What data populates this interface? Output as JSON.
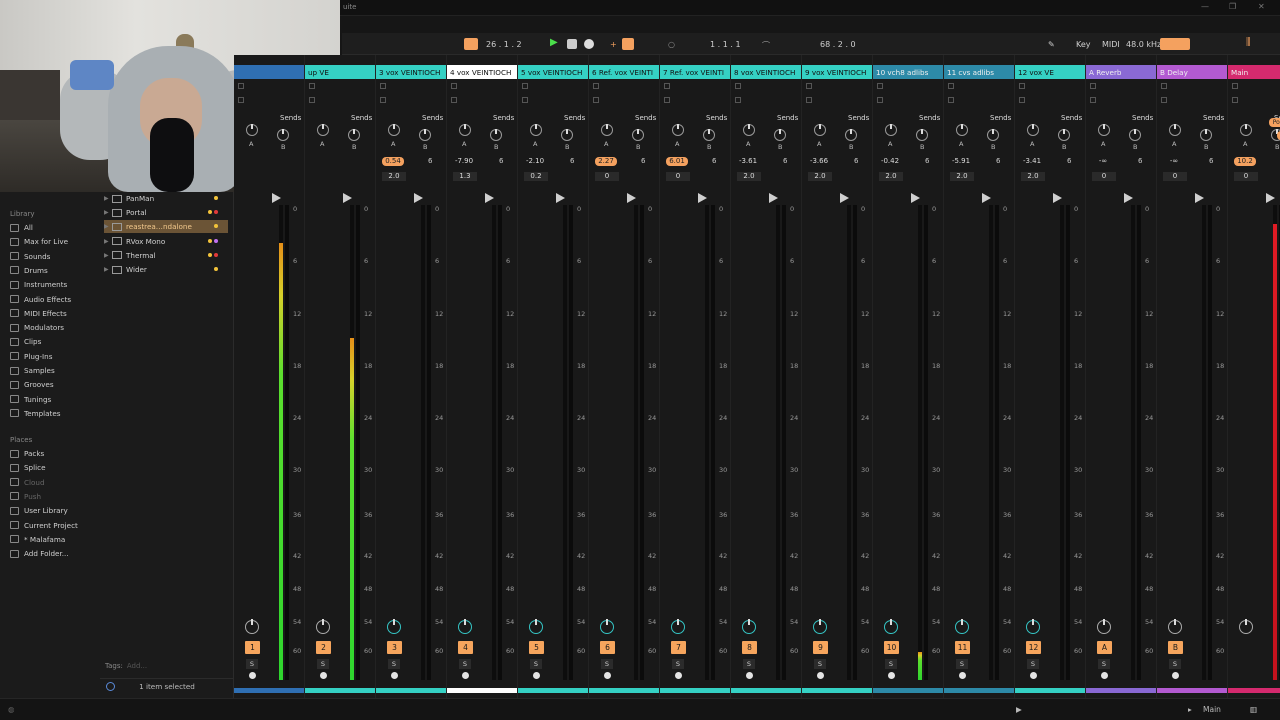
{
  "window": {
    "title_fragment": "uite"
  },
  "transport": {
    "tempo_bar": "26 .  1 .  2",
    "arrangement_pos": "1 .  1 .  1",
    "loop_len": "68 .  2 .  0",
    "key_label": "Key",
    "midi_label": "MIDI",
    "sample_rate": "48.0 kHz",
    "accent": "#f4a15f"
  },
  "library": {
    "title": "Library",
    "items": [
      {
        "label": "All",
        "icon": "list-icon"
      },
      {
        "label": "Max for Live",
        "icon": "max-icon"
      },
      {
        "label": "Sounds",
        "icon": "sounds-icon"
      },
      {
        "label": "Drums",
        "icon": "drums-icon"
      },
      {
        "label": "Instruments",
        "icon": "instruments-icon"
      },
      {
        "label": "Audio Effects",
        "icon": "audio-effects-icon"
      },
      {
        "label": "MIDI Effects",
        "icon": "midi-effects-icon"
      },
      {
        "label": "Modulators",
        "icon": "modulators-icon"
      },
      {
        "label": "Clips",
        "icon": "clips-icon"
      },
      {
        "label": "Plug-Ins",
        "icon": "plugins-icon"
      },
      {
        "label": "Samples",
        "icon": "samples-icon"
      },
      {
        "label": "Grooves",
        "icon": "grooves-icon"
      },
      {
        "label": "Tunings",
        "icon": "tunings-icon"
      },
      {
        "label": "Templates",
        "icon": "templates-icon"
      }
    ],
    "places_title": "Places",
    "places": [
      {
        "label": "Packs",
        "dim": false
      },
      {
        "label": "Splice",
        "dim": false
      },
      {
        "label": "Cloud",
        "dim": true
      },
      {
        "label": "Push",
        "dim": true
      },
      {
        "label": "User Library",
        "dim": false
      },
      {
        "label": "Current Project",
        "dim": false
      },
      {
        "label": "* Malafama",
        "dim": false
      },
      {
        "label": "Add Folder...",
        "dim": false
      }
    ]
  },
  "files": [
    {
      "label": "PanMan",
      "dots": [
        "#f2c33b"
      ],
      "selected": false
    },
    {
      "label": "Portal",
      "dots": [
        "#f2c33b",
        "#e03a3a"
      ],
      "selected": false
    },
    {
      "label": "reastrea…ndalone",
      "dots": [
        "#f2c33b"
      ],
      "selected": true
    },
    {
      "label": "RVox Mono",
      "dots": [
        "#f2c33b",
        "#c070f0"
      ],
      "selected": false
    },
    {
      "label": "Thermal",
      "dots": [
        "#f2c33b",
        "#e03a3a"
      ],
      "selected": false
    },
    {
      "label": "Wider",
      "dots": [
        "#f2c33b"
      ],
      "selected": false
    }
  ],
  "tags": {
    "label": "Tags:",
    "placeholder": "Add..."
  },
  "selection": {
    "text": "1 item selected"
  },
  "mixer": {
    "scale_labels": [
      "0",
      "6",
      "12",
      "18",
      "24",
      "30",
      "36",
      "42",
      "48",
      "54",
      "60"
    ],
    "send_labels": {
      "title": "Sends",
      "a": "A",
      "b": "B"
    },
    "tracks": [
      {
        "num": "1",
        "name": "",
        "color": "#2f6fb3",
        "vol": "",
        "pan": "",
        "meter": 0.92,
        "meterColor": "grad"
      },
      {
        "num": "2",
        "name": "up VE",
        "color": "#35d1c4",
        "vol": "",
        "pan": "",
        "meter": 0.72,
        "meterColor": "grad"
      },
      {
        "num": "3",
        "name": "3 vox VEINTIOCH",
        "color": "#35d1c4",
        "vol": "0.54",
        "hot": true,
        "pan": "2.0",
        "meter": 0,
        "meterColor": "grad"
      },
      {
        "num": "4",
        "name": "4 vox VEINTIOCH",
        "color": "#ffffff",
        "vol": "-7.90",
        "hot": false,
        "pan": "1.3",
        "meter": 0,
        "meterColor": "grad"
      },
      {
        "num": "5",
        "name": "5 vox VEINTIOCH",
        "color": "#35d1c4",
        "vol": "-2.10",
        "hot": false,
        "pan": "0.2",
        "meter": 0,
        "meterColor": "grad"
      },
      {
        "num": "6",
        "name": "6 Ref. vox VEINTI",
        "color": "#35d1c4",
        "vol": "2.27",
        "hot": true,
        "pan": "0",
        "meter": 0,
        "meterColor": "grad"
      },
      {
        "num": "7",
        "name": "7 Ref. vox VEINTI",
        "color": "#35d1c4",
        "vol": "6.01",
        "hot": true,
        "pan": "0",
        "meter": 0,
        "meterColor": "grad"
      },
      {
        "num": "8",
        "name": "8 vox VEINTIOCH",
        "color": "#35d1c4",
        "vol": "-3.61",
        "hot": false,
        "pan": "2.0",
        "meter": 0,
        "meterColor": "grad"
      },
      {
        "num": "9",
        "name": "9 vox VEINTIOCH",
        "color": "#35d1c4",
        "vol": "-3.66",
        "hot": false,
        "pan": "2.0",
        "meter": 0,
        "meterColor": "grad"
      },
      {
        "num": "10",
        "name": "10 vch8 adlibs",
        "color": "#2d8aa8",
        "vol": "-0.42",
        "hot": false,
        "pan": "2.0",
        "meter": 0.06,
        "meterColor": "grad"
      },
      {
        "num": "11",
        "name": "11 cvs adlibs",
        "color": "#2d8aa8",
        "vol": "-5.91",
        "hot": false,
        "pan": "2.0",
        "meter": 0,
        "meterColor": "grad"
      },
      {
        "num": "12",
        "name": "12 vox VE",
        "color": "#35d1c4",
        "vol": "-3.41",
        "hot": false,
        "pan": "2.0",
        "meter": 0,
        "meterColor": "grad"
      },
      {
        "num": "A",
        "name": "A Reverb",
        "color": "#8a69d4",
        "vol": "-∞",
        "hot": false,
        "pan": "0",
        "meter": 0,
        "meterColor": "grad"
      },
      {
        "num": "B",
        "name": "B Delay",
        "color": "#b35ad1",
        "vol": "-∞",
        "hot": false,
        "pan": "0",
        "meter": 0,
        "meterColor": "grad"
      },
      {
        "num": "",
        "name": "Main",
        "color": "#d52a6e",
        "vol": "10.2",
        "hot": true,
        "pan": "0",
        "meter": 0.96,
        "meterColor": "red",
        "post": "Post"
      }
    ]
  },
  "status": {
    "main_label": "Main"
  }
}
